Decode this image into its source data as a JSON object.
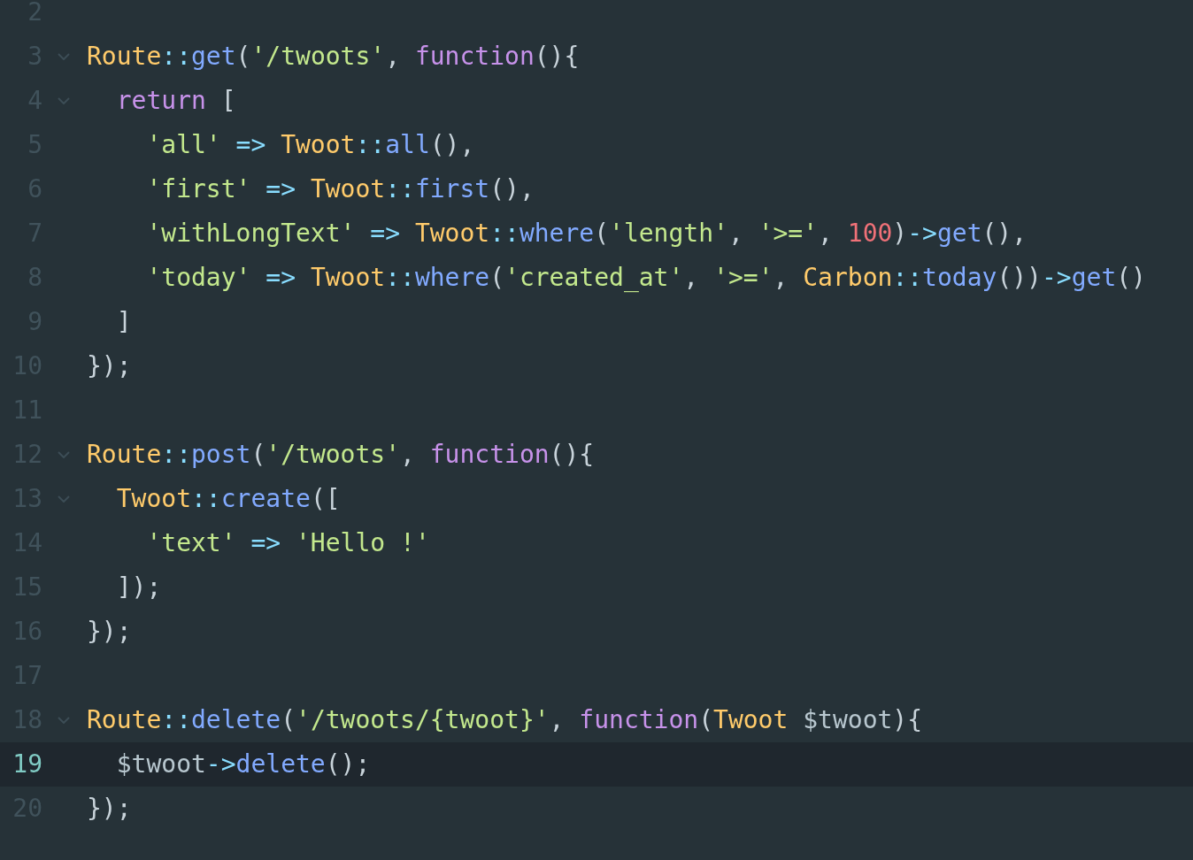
{
  "editor": {
    "lines": [
      {
        "number": "2",
        "fold": false,
        "current": false
      },
      {
        "number": "3",
        "fold": true,
        "current": false,
        "tokens": [
          {
            "kind": "cls",
            "text": "Route"
          },
          {
            "kind": "op",
            "text": "::"
          },
          {
            "kind": "fn",
            "text": "get"
          },
          {
            "kind": "punc",
            "text": "("
          },
          {
            "kind": "str",
            "text": "'/twoots'"
          },
          {
            "kind": "punc",
            "text": ", "
          },
          {
            "kind": "kw",
            "text": "function"
          },
          {
            "kind": "punc",
            "text": "(){"
          }
        ]
      },
      {
        "number": "4",
        "fold": true,
        "current": false,
        "tokens": [
          {
            "kind": "kw",
            "text": "  return"
          },
          {
            "kind": "punc",
            "text": " ["
          }
        ]
      },
      {
        "number": "5",
        "fold": false,
        "current": false,
        "tokens": [
          {
            "kind": "str",
            "text": "    'all'"
          },
          {
            "kind": "op",
            "text": " => "
          },
          {
            "kind": "cls",
            "text": "Twoot"
          },
          {
            "kind": "op",
            "text": "::"
          },
          {
            "kind": "fn",
            "text": "all"
          },
          {
            "kind": "punc",
            "text": "(),"
          }
        ]
      },
      {
        "number": "6",
        "fold": false,
        "current": false,
        "tokens": [
          {
            "kind": "str",
            "text": "    'first'"
          },
          {
            "kind": "op",
            "text": " => "
          },
          {
            "kind": "cls",
            "text": "Twoot"
          },
          {
            "kind": "op",
            "text": "::"
          },
          {
            "kind": "fn",
            "text": "first"
          },
          {
            "kind": "punc",
            "text": "(),"
          }
        ]
      },
      {
        "number": "7",
        "fold": false,
        "current": false,
        "tokens": [
          {
            "kind": "str",
            "text": "    'withLongText'"
          },
          {
            "kind": "op",
            "text": " => "
          },
          {
            "kind": "cls",
            "text": "Twoot"
          },
          {
            "kind": "op",
            "text": "::"
          },
          {
            "kind": "fn",
            "text": "where"
          },
          {
            "kind": "punc",
            "text": "("
          },
          {
            "kind": "str",
            "text": "'length'"
          },
          {
            "kind": "punc",
            "text": ", "
          },
          {
            "kind": "str",
            "text": "'>='"
          },
          {
            "kind": "punc",
            "text": ", "
          },
          {
            "kind": "num",
            "text": "100"
          },
          {
            "kind": "punc",
            "text": ")"
          },
          {
            "kind": "op",
            "text": "->"
          },
          {
            "kind": "fn",
            "text": "get"
          },
          {
            "kind": "punc",
            "text": "(),"
          }
        ]
      },
      {
        "number": "8",
        "fold": false,
        "current": false,
        "tokens": [
          {
            "kind": "str",
            "text": "    'today'"
          },
          {
            "kind": "op",
            "text": " => "
          },
          {
            "kind": "cls",
            "text": "Twoot"
          },
          {
            "kind": "op",
            "text": "::"
          },
          {
            "kind": "fn",
            "text": "where"
          },
          {
            "kind": "punc",
            "text": "("
          },
          {
            "kind": "str",
            "text": "'created_at'"
          },
          {
            "kind": "punc",
            "text": ", "
          },
          {
            "kind": "str",
            "text": "'>='"
          },
          {
            "kind": "punc",
            "text": ", "
          },
          {
            "kind": "cls",
            "text": "Carbon"
          },
          {
            "kind": "op",
            "text": "::"
          },
          {
            "kind": "fn",
            "text": "today"
          },
          {
            "kind": "punc",
            "text": "())"
          },
          {
            "kind": "op",
            "text": "->"
          },
          {
            "kind": "fn",
            "text": "get"
          },
          {
            "kind": "punc",
            "text": "()"
          }
        ]
      },
      {
        "number": "9",
        "fold": false,
        "current": false,
        "tokens": [
          {
            "kind": "punc",
            "text": "  ]"
          }
        ]
      },
      {
        "number": "10",
        "fold": false,
        "current": false,
        "tokens": [
          {
            "kind": "punc",
            "text": "});"
          }
        ]
      },
      {
        "number": "11",
        "fold": false,
        "current": false
      },
      {
        "number": "12",
        "fold": true,
        "current": false,
        "tokens": [
          {
            "kind": "cls",
            "text": "Route"
          },
          {
            "kind": "op",
            "text": "::"
          },
          {
            "kind": "fn",
            "text": "post"
          },
          {
            "kind": "punc",
            "text": "("
          },
          {
            "kind": "str",
            "text": "'/twoots'"
          },
          {
            "kind": "punc",
            "text": ", "
          },
          {
            "kind": "kw",
            "text": "function"
          },
          {
            "kind": "punc",
            "text": "(){"
          }
        ]
      },
      {
        "number": "13",
        "fold": true,
        "current": false,
        "tokens": [
          {
            "kind": "cls",
            "text": "  Twoot"
          },
          {
            "kind": "op",
            "text": "::"
          },
          {
            "kind": "fn",
            "text": "create"
          },
          {
            "kind": "punc",
            "text": "(["
          }
        ]
      },
      {
        "number": "14",
        "fold": false,
        "current": false,
        "tokens": [
          {
            "kind": "str",
            "text": "    'text'"
          },
          {
            "kind": "op",
            "text": " => "
          },
          {
            "kind": "str",
            "text": "'Hello !'"
          }
        ]
      },
      {
        "number": "15",
        "fold": false,
        "current": false,
        "tokens": [
          {
            "kind": "punc",
            "text": "  ]);"
          }
        ]
      },
      {
        "number": "16",
        "fold": false,
        "current": false,
        "tokens": [
          {
            "kind": "punc",
            "text": "});"
          }
        ]
      },
      {
        "number": "17",
        "fold": false,
        "current": false
      },
      {
        "number": "18",
        "fold": true,
        "current": false,
        "tokens": [
          {
            "kind": "cls",
            "text": "Route"
          },
          {
            "kind": "op",
            "text": "::"
          },
          {
            "kind": "fn",
            "text": "delete"
          },
          {
            "kind": "punc",
            "text": "("
          },
          {
            "kind": "str",
            "text": "'/twoots/{twoot}'"
          },
          {
            "kind": "punc",
            "text": ", "
          },
          {
            "kind": "kw",
            "text": "function"
          },
          {
            "kind": "punc",
            "text": "("
          },
          {
            "kind": "cls",
            "text": "Twoot"
          },
          {
            "kind": "var",
            "text": " $twoot"
          },
          {
            "kind": "punc",
            "text": "){"
          }
        ]
      },
      {
        "number": "19",
        "fold": false,
        "current": true,
        "tokens": [
          {
            "kind": "var",
            "text": "  $twoot"
          },
          {
            "kind": "op",
            "text": "->"
          },
          {
            "kind": "fn",
            "text": "delete"
          },
          {
            "kind": "punc",
            "text": "();"
          }
        ]
      },
      {
        "number": "20",
        "fold": false,
        "current": false,
        "tokens": [
          {
            "kind": "punc",
            "text": "});"
          }
        ]
      }
    ]
  }
}
